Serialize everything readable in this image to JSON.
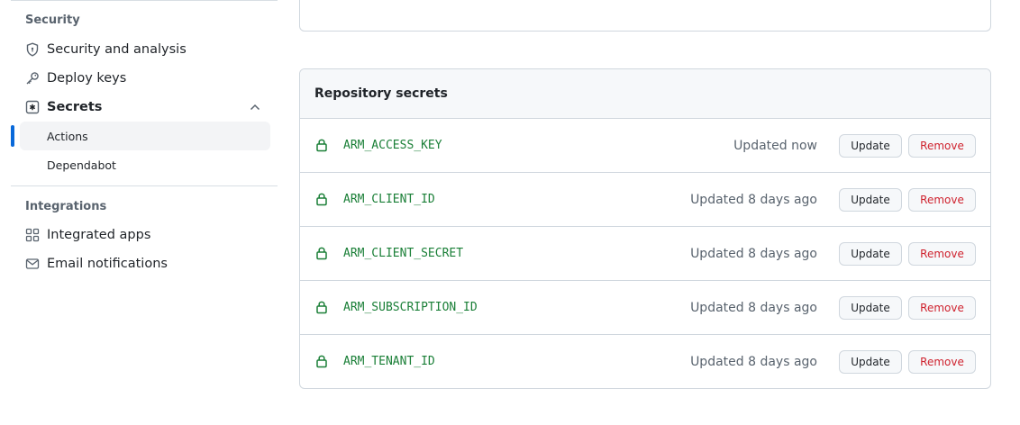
{
  "sidebar": {
    "security_heading": "Security",
    "items": [
      {
        "label": "Security and analysis",
        "icon": "shield-icon"
      },
      {
        "label": "Deploy keys",
        "icon": "key-icon"
      },
      {
        "label": "Secrets",
        "icon": "asterisk-box-icon"
      }
    ],
    "secrets_children": [
      {
        "label": "Actions",
        "active": true
      },
      {
        "label": "Dependabot",
        "active": false
      }
    ],
    "integrations_heading": "Integrations",
    "integration_items": [
      {
        "label": "Integrated apps",
        "icon": "apps-grid-icon"
      },
      {
        "label": "Email notifications",
        "icon": "mail-icon"
      }
    ]
  },
  "main": {
    "repo_secrets_title": "Repository secrets",
    "update_label": "Update",
    "remove_label": "Remove",
    "secrets": [
      {
        "name": "ARM_ACCESS_KEY",
        "updated": "Updated now"
      },
      {
        "name": "ARM_CLIENT_ID",
        "updated": "Updated 8 days ago"
      },
      {
        "name": "ARM_CLIENT_SECRET",
        "updated": "Updated 8 days ago"
      },
      {
        "name": "ARM_SUBSCRIPTION_ID",
        "updated": "Updated 8 days ago"
      },
      {
        "name": "ARM_TENANT_ID",
        "updated": "Updated 8 days ago"
      }
    ]
  },
  "colors": {
    "accent": "#0969da",
    "secret_name": "#1a7f37",
    "danger": "#cf222e"
  }
}
